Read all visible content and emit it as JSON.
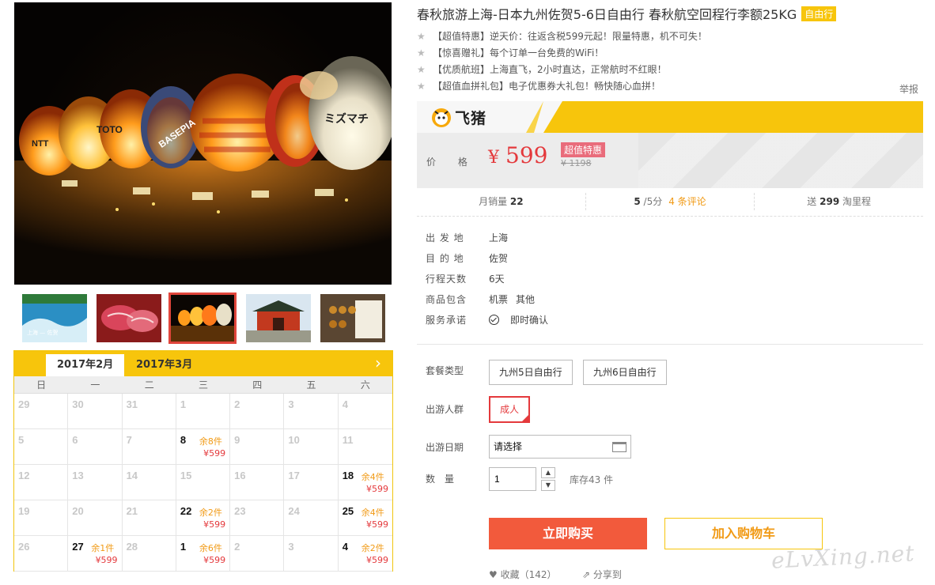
{
  "product": {
    "title": "春秋旅游上海-日本九州佐贺5-6日自由行 春秋航空回程行李额25KG",
    "tag": "自由行",
    "promos": [
      "【超值特惠】逆天价：往返含税599元起！限量特惠，机不可失！",
      "【惊喜赠礼】每个订单一台免费的WiFi！",
      "【优质航班】上海直飞，2小时直达，正常航时不红眼！",
      "【超值血拼礼包】电子优惠券大礼包！畅快随心血拼！"
    ],
    "report_label": "举报"
  },
  "brand": {
    "name": "飞猪",
    "color": "#f7c50c"
  },
  "price": {
    "label": "价 格",
    "currency": "¥",
    "value": "599",
    "badge": "超值特惠",
    "original": "¥ 1198"
  },
  "stats": {
    "sales_label": "月销量",
    "sales_value": "22",
    "rating_value": "5",
    "rating_suffix": "/5分",
    "reviews_link": "4 条评论",
    "points_prefix": "送",
    "points_value": "299",
    "points_suffix": "淘里程"
  },
  "info": {
    "depart_label": "出 发 地",
    "depart": "上海",
    "dest_label": "目 的 地",
    "dest": "佐贺",
    "days_label": "行程天数",
    "days": "6天",
    "includes_label": "商品包含",
    "includes": [
      "机票",
      "其他"
    ],
    "promise_label": "服务承诺",
    "promise": "即时确认"
  },
  "options": {
    "package_label": "套餐类型",
    "packages": [
      "九州5日自由行",
      "九州6日自由行"
    ],
    "group_label": "出游人群",
    "groups": [
      "成人"
    ],
    "date_label": "出游日期",
    "date_value": "请选择",
    "qty_label": "数　量",
    "qty_value": "1",
    "stock_note": "库存43 件"
  },
  "actions": {
    "buy": "立即购买",
    "cart": "加入购物车",
    "fav": "收藏（142）",
    "share": "分享到"
  },
  "calendar": {
    "months": [
      "2017年2月",
      "2017年3月"
    ],
    "active_month": 0,
    "next_icon": "chevron-right-icon",
    "weekdays": [
      "日",
      "一",
      "二",
      "三",
      "四",
      "五",
      "六"
    ],
    "cells": [
      {
        "d": "29"
      },
      {
        "d": "30"
      },
      {
        "d": "31"
      },
      {
        "d": "1"
      },
      {
        "d": "2"
      },
      {
        "d": "3"
      },
      {
        "d": "4"
      },
      {
        "d": "5"
      },
      {
        "d": "6"
      },
      {
        "d": "7"
      },
      {
        "d": "8",
        "stock": "余8件",
        "price": "¥599"
      },
      {
        "d": "9"
      },
      {
        "d": "10"
      },
      {
        "d": "11"
      },
      {
        "d": "12"
      },
      {
        "d": "13"
      },
      {
        "d": "14"
      },
      {
        "d": "15"
      },
      {
        "d": "16"
      },
      {
        "d": "17"
      },
      {
        "d": "18",
        "stock": "余4件",
        "price": "¥599"
      },
      {
        "d": "19"
      },
      {
        "d": "20"
      },
      {
        "d": "21"
      },
      {
        "d": "22",
        "stock": "余2件",
        "price": "¥599"
      },
      {
        "d": "23"
      },
      {
        "d": "24"
      },
      {
        "d": "25",
        "stock": "余4件",
        "price": "¥599"
      },
      {
        "d": "26"
      },
      {
        "d": "27",
        "stock": "余1件",
        "price": "¥599"
      },
      {
        "d": "28"
      },
      {
        "d": "1",
        "stock": "余6件",
        "price": "¥599"
      },
      {
        "d": "2"
      },
      {
        "d": "3"
      },
      {
        "d": "4",
        "stock": "余2件",
        "price": "¥599"
      }
    ]
  },
  "gallery": {
    "active_thumb": 2,
    "balloon_texts": [
      "NTT",
      "TOTO",
      "BASEPIA",
      "ミズマチ"
    ],
    "thumb1_text": "上海 — 佐贺"
  },
  "watermark": "eLvXing.net"
}
